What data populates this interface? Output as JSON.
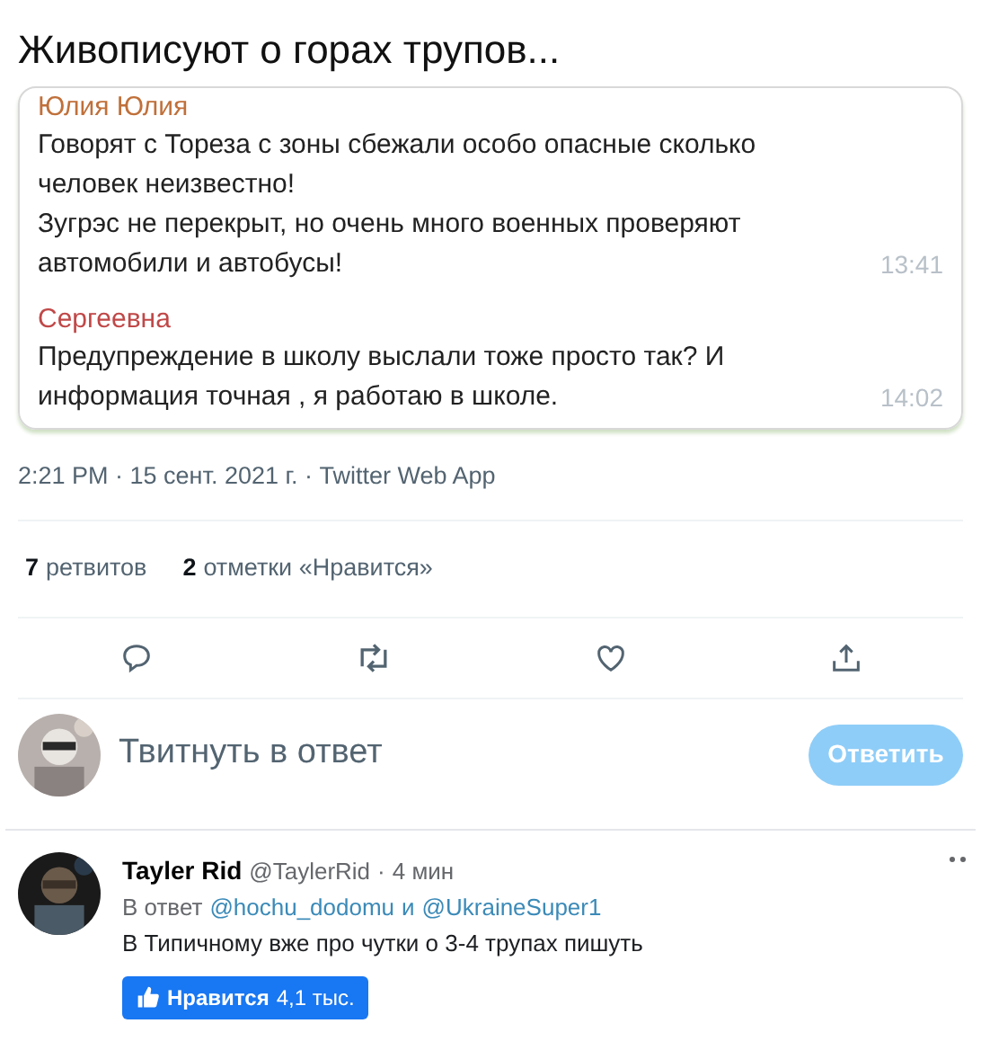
{
  "heading": "Живописуют о горах трупов...",
  "messages": [
    {
      "author": "Юлия Юлия",
      "color": "#c0703a",
      "lines": [
        "Говорят с Тореза с зоны сбежали особо опасные сколько",
        "человек неизвестно!",
        "Зугрэс не перекрыт, но очень много военных проверяют",
        "автомобили и автобусы!"
      ],
      "time": "13:41"
    },
    {
      "author": "Сергеевна",
      "color": "#c04848",
      "lines": [
        "Предупреждение в школу выслали тоже просто так? И",
        "информация точная , я работаю в школе."
      ],
      "time": "14:02"
    }
  ],
  "meta": "2:21 PM · 15 сент. 2021 г. · Twitter Web App",
  "stats": [
    {
      "count": "7",
      "label": "ретвитов"
    },
    {
      "count": "2",
      "label": "отметки «Нравится»"
    }
  ],
  "reply": {
    "placeholder": "Твитнуть в ответ",
    "button": "Ответить"
  },
  "comment": {
    "name": "Tayler Rid",
    "handle": "@TaylerRid",
    "dot": "·",
    "time": "4 мин",
    "reply_prefix": "В ответ",
    "mentions": [
      "@hochu_dodomu",
      "@UkraineSuper1"
    ],
    "joiner": "и",
    "text": "В Типичному вже про чутки о 3-4 трупах пишуть",
    "like_label": "Нравится",
    "like_count": "4,1 тыс."
  }
}
